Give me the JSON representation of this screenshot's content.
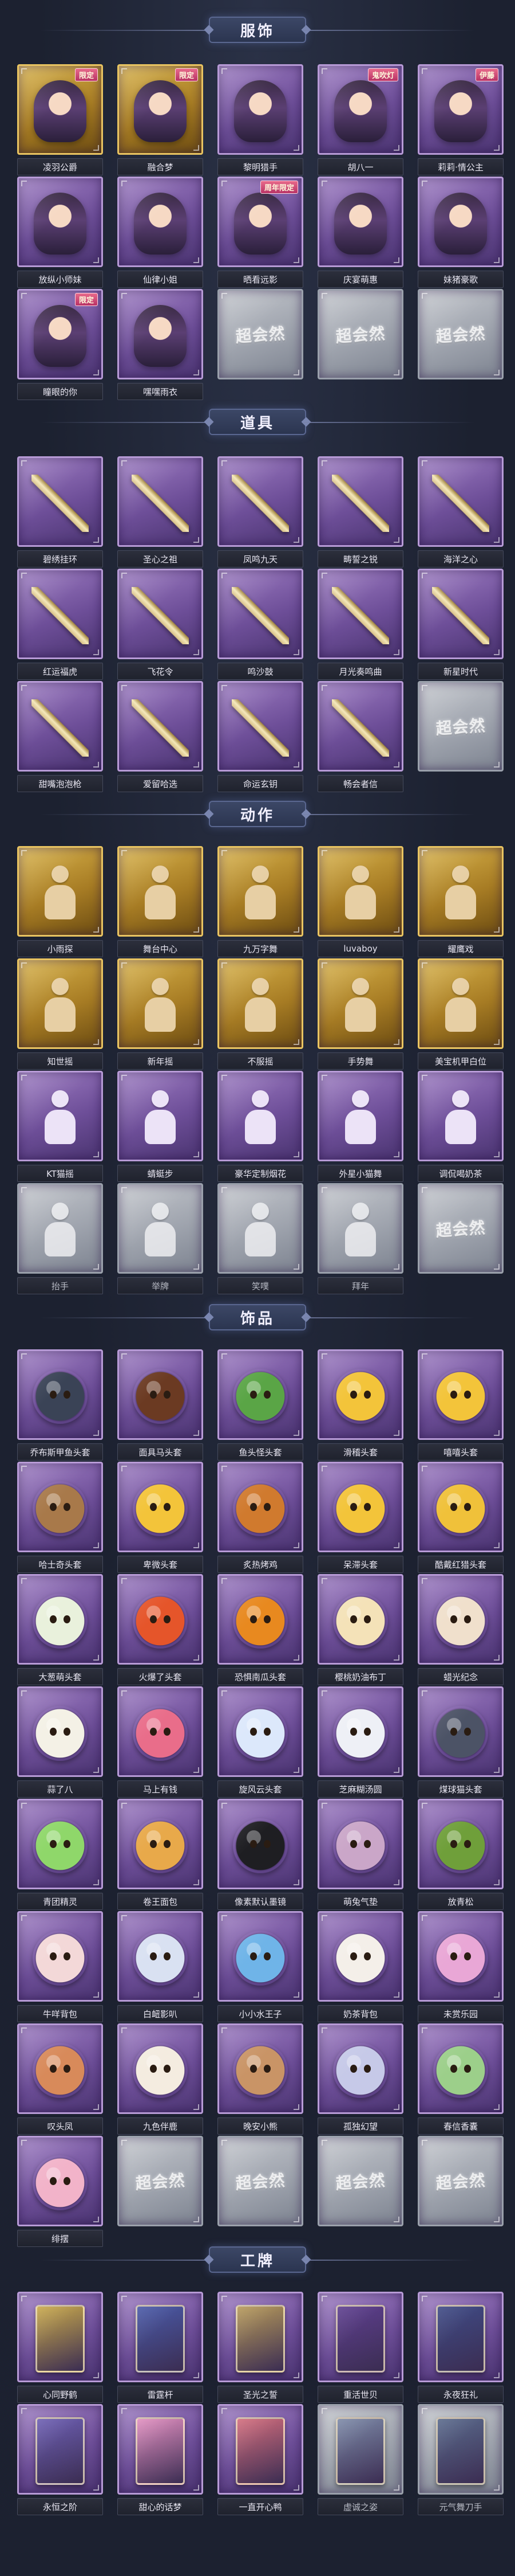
{
  "sections": {
    "costumes": {
      "title": "服饰",
      "items": [
        {
          "label": "凌羽公爵",
          "tone": "gold",
          "kind": "portrait",
          "badge": "限定"
        },
        {
          "label": "融合梦",
          "tone": "gold",
          "kind": "portrait",
          "badge": "限定"
        },
        {
          "label": "黎明猎手",
          "tone": "purple",
          "kind": "portrait",
          "badge": ""
        },
        {
          "label": "胡八一",
          "tone": "purple",
          "kind": "portrait",
          "badge": "鬼吹灯"
        },
        {
          "label": "莉莉·情公主",
          "tone": "purple",
          "kind": "portrait",
          "badge": "伊藤"
        },
        {
          "label": "放纵小师妹",
          "tone": "purple",
          "kind": "portrait",
          "badge": ""
        },
        {
          "label": "仙律小姐",
          "tone": "purple",
          "kind": "portrait",
          "badge": ""
        },
        {
          "label": "晒看远影",
          "tone": "purple",
          "kind": "portrait",
          "badge": "周年限定"
        },
        {
          "label": "庆宴萌惠",
          "tone": "purple",
          "kind": "portrait",
          "badge": ""
        },
        {
          "label": "妹猪豪歌",
          "tone": "purple",
          "kind": "portrait",
          "badge": ""
        },
        {
          "label": "瞳眼的你",
          "tone": "purple",
          "kind": "portrait",
          "badge": "限定"
        },
        {
          "label": "嘿嘿雨衣",
          "tone": "purple",
          "kind": "portrait",
          "badge": ""
        },
        {
          "label": "",
          "tone": "grey",
          "kind": "locked",
          "badge": ""
        },
        {
          "label": "",
          "tone": "grey",
          "kind": "locked",
          "badge": ""
        },
        {
          "label": "",
          "tone": "grey",
          "kind": "locked",
          "badge": ""
        }
      ]
    },
    "props": {
      "title": "道具",
      "items": [
        {
          "label": "碧绣挂环",
          "tone": "purple",
          "kind": "weapon",
          "badge": ""
        },
        {
          "label": "圣心之祖",
          "tone": "purple",
          "kind": "weapon",
          "badge": ""
        },
        {
          "label": "凤鸣九天",
          "tone": "purple",
          "kind": "weapon",
          "badge": ""
        },
        {
          "label": "畴誓之锐",
          "tone": "purple",
          "kind": "weapon",
          "badge": ""
        },
        {
          "label": "海洋之心",
          "tone": "purple",
          "kind": "weapon",
          "badge": ""
        },
        {
          "label": "红运福虎",
          "tone": "purple",
          "kind": "weapon",
          "badge": ""
        },
        {
          "label": "飞花令",
          "tone": "purple",
          "kind": "weapon",
          "badge": ""
        },
        {
          "label": "鸣沙鼓",
          "tone": "purple",
          "kind": "weapon",
          "badge": ""
        },
        {
          "label": "月光奏鸣曲",
          "tone": "purple",
          "kind": "weapon",
          "badge": ""
        },
        {
          "label": "新星时代",
          "tone": "purple",
          "kind": "weapon",
          "badge": ""
        },
        {
          "label": "甜嘴泡泡枪",
          "tone": "purple",
          "kind": "weapon",
          "badge": ""
        },
        {
          "label": "爱留哈选",
          "tone": "purple",
          "kind": "weapon",
          "badge": ""
        },
        {
          "label": "命运玄钥",
          "tone": "purple",
          "kind": "weapon",
          "badge": ""
        },
        {
          "label": "畅会者信",
          "tone": "purple",
          "kind": "weapon",
          "badge": ""
        },
        {
          "label": "",
          "tone": "grey",
          "kind": "locked",
          "badge": ""
        }
      ]
    },
    "actions": {
      "title": "动作",
      "items": [
        {
          "label": "小雨探",
          "tone": "gold",
          "kind": "emote",
          "badge": ""
        },
        {
          "label": "舞台中心",
          "tone": "gold",
          "kind": "emote",
          "badge": ""
        },
        {
          "label": "九万字舞",
          "tone": "gold",
          "kind": "emote",
          "badge": ""
        },
        {
          "label": "luvaboy",
          "tone": "gold",
          "kind": "emote",
          "badge": ""
        },
        {
          "label": "耀鹰戏",
          "tone": "gold",
          "kind": "emote",
          "badge": ""
        },
        {
          "label": "知世摇",
          "tone": "gold",
          "kind": "emote",
          "badge": ""
        },
        {
          "label": "新年摇",
          "tone": "gold",
          "kind": "emote",
          "badge": ""
        },
        {
          "label": "不服摇",
          "tone": "gold",
          "kind": "emote",
          "badge": ""
        },
        {
          "label": "手势舞",
          "tone": "gold",
          "kind": "emote",
          "badge": ""
        },
        {
          "label": "美宝机甲白位",
          "tone": "gold",
          "kind": "emote",
          "badge": ""
        },
        {
          "label": "KT猫摇",
          "tone": "purple",
          "kind": "emote",
          "badge": ""
        },
        {
          "label": "蜻蜓步",
          "tone": "purple",
          "kind": "emote",
          "badge": ""
        },
        {
          "label": "豪华定制烟花",
          "tone": "purple",
          "kind": "emote",
          "badge": ""
        },
        {
          "label": "外星小猫舞",
          "tone": "purple",
          "kind": "emote",
          "badge": ""
        },
        {
          "label": "调侃喝奶茶",
          "tone": "purple",
          "kind": "emote",
          "badge": ""
        },
        {
          "label": "抬手",
          "tone": "grey",
          "kind": "emote",
          "badge": ""
        },
        {
          "label": "举牌",
          "tone": "grey",
          "kind": "emote",
          "badge": ""
        },
        {
          "label": "笑噗",
          "tone": "grey",
          "kind": "emote",
          "badge": ""
        },
        {
          "label": "拜年",
          "tone": "grey",
          "kind": "emote",
          "badge": ""
        },
        {
          "label": "",
          "tone": "grey",
          "kind": "locked",
          "badge": ""
        }
      ]
    },
    "accessories": {
      "title": "饰品",
      "items": [
        {
          "label": "乔布斯甲鱼头套",
          "tone": "purple",
          "kind": "head",
          "color": "#3a4356",
          "badge": ""
        },
        {
          "label": "面具马头套",
          "tone": "purple",
          "kind": "head",
          "color": "#6b3a22",
          "badge": ""
        },
        {
          "label": "鱼头怪头套",
          "tone": "purple",
          "kind": "head",
          "color": "#5aa546",
          "badge": ""
        },
        {
          "label": "滑稽头套",
          "tone": "purple",
          "kind": "head",
          "color": "#f3c43a",
          "badge": ""
        },
        {
          "label": "嘻嘻头套",
          "tone": "purple",
          "kind": "head",
          "color": "#f3c43a",
          "badge": ""
        },
        {
          "label": "哈士奇头套",
          "tone": "purple",
          "kind": "head",
          "color": "#a8794a",
          "badge": ""
        },
        {
          "label": "卑微头套",
          "tone": "purple",
          "kind": "head",
          "color": "#f3c43a",
          "badge": ""
        },
        {
          "label": "炙热烤鸡",
          "tone": "purple",
          "kind": "head",
          "color": "#d07a2e",
          "badge": ""
        },
        {
          "label": "呆滞头套",
          "tone": "purple",
          "kind": "head",
          "color": "#f3c43a",
          "badge": ""
        },
        {
          "label": "酷戴红猎头套",
          "tone": "purple",
          "kind": "head",
          "color": "#f0c13a",
          "badge": ""
        },
        {
          "label": "大葱萌头套",
          "tone": "purple",
          "kind": "head",
          "color": "#e9f1dc",
          "badge": ""
        },
        {
          "label": "火爆了头套",
          "tone": "purple",
          "kind": "head",
          "color": "#e5552a",
          "badge": ""
        },
        {
          "label": "恐惧南瓜头套",
          "tone": "purple",
          "kind": "head",
          "color": "#e8891f",
          "badge": ""
        },
        {
          "label": "樱桃奶油布丁",
          "tone": "purple",
          "kind": "head",
          "color": "#f4e2b8",
          "badge": ""
        },
        {
          "label": "蜡光纪念",
          "tone": "purple",
          "kind": "head",
          "color": "#f0e0cc",
          "badge": ""
        },
        {
          "label": "蒜了八",
          "tone": "purple",
          "kind": "head",
          "color": "#f4f1e6",
          "badge": ""
        },
        {
          "label": "马上有钱",
          "tone": "purple",
          "kind": "head",
          "color": "#e96d8a",
          "badge": ""
        },
        {
          "label": "旋风云头套",
          "tone": "purple",
          "kind": "head",
          "color": "#dce8fb",
          "badge": ""
        },
        {
          "label": "芝麻糊汤圆",
          "tone": "purple",
          "kind": "head",
          "color": "#eef0f6",
          "badge": ""
        },
        {
          "label": "煤球猫头套",
          "tone": "purple",
          "kind": "head",
          "color": "#4c5366",
          "badge": ""
        },
        {
          "label": "青团精灵",
          "tone": "purple",
          "kind": "head",
          "color": "#8fd76a",
          "badge": ""
        },
        {
          "label": "卷王面包",
          "tone": "purple",
          "kind": "head",
          "color": "#e8a94a",
          "badge": ""
        },
        {
          "label": "像素默认墨镜",
          "tone": "purple",
          "kind": "head",
          "color": "#1e1e22",
          "badge": ""
        },
        {
          "label": "萌兔气垫",
          "tone": "purple",
          "kind": "head",
          "color": "#caa6c8",
          "badge": ""
        },
        {
          "label": "放青松",
          "tone": "purple",
          "kind": "head",
          "color": "#6f9f3a",
          "badge": ""
        },
        {
          "label": "牛咩背包",
          "tone": "purple",
          "kind": "head",
          "color": "#f3d8d8",
          "badge": ""
        },
        {
          "label": "白衄影叭",
          "tone": "purple",
          "kind": "head",
          "color": "#d9e1f2",
          "badge": ""
        },
        {
          "label": "小小水王子",
          "tone": "purple",
          "kind": "head",
          "color": "#6fb4e8",
          "badge": ""
        },
        {
          "label": "奶茶背包",
          "tone": "purple",
          "kind": "head",
          "color": "#f4efe9",
          "badge": ""
        },
        {
          "label": "未赏乐园",
          "tone": "purple",
          "kind": "head",
          "color": "#e9a7d6",
          "badge": ""
        },
        {
          "label": "叹头凤",
          "tone": "purple",
          "kind": "head",
          "color": "#d88a5a",
          "badge": ""
        },
        {
          "label": "九色伴鹿",
          "tone": "purple",
          "kind": "head",
          "color": "#f4ece0",
          "badge": ""
        },
        {
          "label": "晚安小熊",
          "tone": "purple",
          "kind": "head",
          "color": "#c99466",
          "badge": ""
        },
        {
          "label": "孤独幻望",
          "tone": "purple",
          "kind": "head",
          "color": "#c6c9e8",
          "badge": ""
        },
        {
          "label": "春信香囊",
          "tone": "purple",
          "kind": "head",
          "color": "#9ccf8a",
          "badge": ""
        },
        {
          "label": "绯摆",
          "tone": "purple",
          "kind": "head",
          "color": "#f2b3c9",
          "badge": ""
        },
        {
          "label": "",
          "tone": "grey",
          "kind": "locked",
          "badge": ""
        },
        {
          "label": "",
          "tone": "grey",
          "kind": "locked",
          "badge": ""
        },
        {
          "label": "",
          "tone": "grey",
          "kind": "locked",
          "badge": ""
        },
        {
          "label": "",
          "tone": "grey",
          "kind": "locked",
          "badge": ""
        }
      ]
    },
    "cards": {
      "title": "工牌",
      "items": [
        {
          "label": "心同野鹤",
          "tone": "purple",
          "kind": "card",
          "color": "#c9a94b",
          "badge": ""
        },
        {
          "label": "雷霆杆",
          "tone": "purple",
          "kind": "card",
          "color": "#4a5aa8",
          "badge": ""
        },
        {
          "label": "圣光之誓",
          "tone": "purple",
          "kind": "card",
          "color": "#b79a5a",
          "badge": ""
        },
        {
          "label": "重活世贝",
          "tone": "purple",
          "kind": "card",
          "color": "#5e3f8f",
          "badge": ""
        },
        {
          "label": "永夜狂礼",
          "tone": "purple",
          "kind": "card",
          "color": "#3f4b86",
          "badge": ""
        },
        {
          "label": "永恒之阶",
          "tone": "purple",
          "kind": "card",
          "color": "#6d5fb3",
          "badge": ""
        },
        {
          "label": "甜心的话梦",
          "tone": "purple",
          "kind": "card",
          "color": "#e18fc0",
          "badge": ""
        },
        {
          "label": "一直开心鸭",
          "tone": "purple",
          "kind": "card",
          "color": "#d26d7d",
          "badge": ""
        },
        {
          "label": "虚诚之姿",
          "tone": "grey",
          "kind": "card",
          "color": "#7d8aa8",
          "badge": ""
        },
        {
          "label": "元气舞刀手",
          "tone": "grey",
          "kind": "card",
          "color": "#5a6a8c",
          "badge": ""
        }
      ]
    }
  },
  "locked_logo": "超会然"
}
